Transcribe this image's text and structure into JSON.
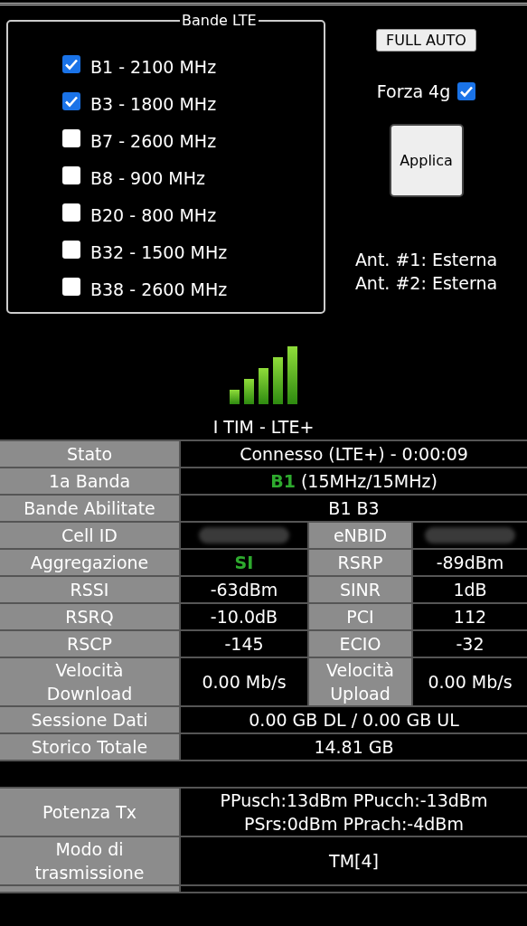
{
  "bands_panel": {
    "title": "Bande LTE",
    "bands": [
      {
        "label": "B1 - 2100 MHz",
        "checked": true
      },
      {
        "label": "B3 - 1800 MHz",
        "checked": true
      },
      {
        "label": "B7 - 2600 MHz",
        "checked": false
      },
      {
        "label": "B8 - 900 MHz",
        "checked": false
      },
      {
        "label": "B20 - 800 MHz",
        "checked": false
      },
      {
        "label": "B32 - 1500 MHz",
        "checked": false
      },
      {
        "label": "B38 - 2600 MHz",
        "checked": false
      }
    ]
  },
  "controls": {
    "full_auto_button": "FULL AUTO",
    "force_4g": {
      "label": "Forza 4g",
      "checked": true
    },
    "apply_button": "Applica",
    "antennas": [
      "Ant. #1: Esterna",
      "Ant. #2: Esterna"
    ]
  },
  "operator": "I TIM - LTE+",
  "table": {
    "rows": [
      {
        "kind": "pair",
        "cells": [
          {
            "kind": "label",
            "text": "Stato"
          },
          {
            "kind": "value",
            "text": "Connesso (LTE+) - 0:00:09"
          }
        ]
      },
      {
        "kind": "pair",
        "cells": [
          {
            "kind": "label",
            "text": "1a Banda"
          },
          {
            "kind": "value",
            "text": "**B1** (15MHz/15MHz)"
          }
        ]
      },
      {
        "kind": "pair",
        "cells": [
          {
            "kind": "label",
            "text": "Bande Abilitate"
          },
          {
            "kind": "value",
            "text": "B1 B3"
          }
        ]
      },
      {
        "kind": "quad",
        "cells": [
          {
            "kind": "label",
            "text": "Cell ID"
          },
          {
            "kind": "redacted"
          },
          {
            "kind": "label",
            "text": "eNBID"
          },
          {
            "kind": "redacted"
          }
        ]
      },
      {
        "kind": "quad",
        "cells": [
          {
            "kind": "label",
            "text": "Aggregazione"
          },
          {
            "kind": "value",
            "text": "SI",
            "highlight": true
          },
          {
            "kind": "label",
            "text": "RSRP"
          },
          {
            "kind": "value",
            "text": "-89dBm"
          }
        ]
      },
      {
        "kind": "quad",
        "cells": [
          {
            "kind": "label",
            "text": "RSSI"
          },
          {
            "kind": "value",
            "text": "-63dBm"
          },
          {
            "kind": "label",
            "text": "SINR"
          },
          {
            "kind": "value",
            "text": "1dB"
          }
        ]
      },
      {
        "kind": "quad",
        "cells": [
          {
            "kind": "label",
            "text": "RSRQ"
          },
          {
            "kind": "value",
            "text": "-10.0dB"
          },
          {
            "kind": "label",
            "text": "PCI"
          },
          {
            "kind": "value",
            "text": "112"
          }
        ]
      },
      {
        "kind": "quad",
        "cells": [
          {
            "kind": "label",
            "text": "RSCP"
          },
          {
            "kind": "value",
            "text": "-145"
          },
          {
            "kind": "label",
            "text": "ECIO"
          },
          {
            "kind": "value",
            "text": "-32"
          }
        ]
      },
      {
        "kind": "quad",
        "cells": [
          {
            "kind": "label",
            "text": "Velocità Download"
          },
          {
            "kind": "value",
            "text": "0.00 Mb/s"
          },
          {
            "kind": "label",
            "text": "Velocità Upload"
          },
          {
            "kind": "value",
            "text": "0.00 Mb/s"
          }
        ]
      },
      {
        "kind": "pair",
        "cells": [
          {
            "kind": "label",
            "text": "Sessione Dati"
          },
          {
            "kind": "value",
            "text": "0.00 GB DL / 0.00 GB UL"
          }
        ]
      },
      {
        "kind": "pair",
        "cells": [
          {
            "kind": "label",
            "text": "Storico Totale"
          },
          {
            "kind": "value",
            "text": "14.81 GB"
          }
        ]
      },
      {
        "kind": "gap"
      },
      {
        "kind": "pair",
        "cells": [
          {
            "kind": "label",
            "text": "Potenza Tx"
          },
          {
            "kind": "value",
            "text": "PPusch:13dBm PPucch:-13dBm PSrs:0dBm PPrach:-4dBm"
          }
        ]
      },
      {
        "kind": "pair",
        "cells": [
          {
            "kind": "label",
            "text": "Modo di trasmissione"
          },
          {
            "kind": "value",
            "text": "TM[4]"
          }
        ]
      },
      {
        "kind": "cut"
      }
    ]
  }
}
